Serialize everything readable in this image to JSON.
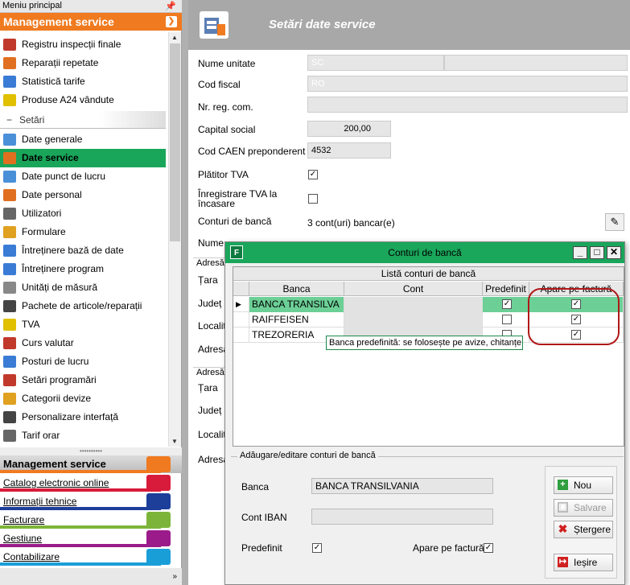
{
  "left_pane": {
    "title": "Meniu principal",
    "pin": "⌂",
    "module_header": "Management service",
    "nav_items": [
      {
        "label": "Registru inspecții finale",
        "icon": "registry-icon",
        "color": "#c0392b"
      },
      {
        "label": "Reparații repetate",
        "icon": "repair-icon",
        "color": "#e07020"
      },
      {
        "label": "Statistică tarife",
        "icon": "chart-icon",
        "color": "#3a7bd5"
      },
      {
        "label": "Produse A24 vândute",
        "icon": "a24-icon",
        "color": "#e0c000"
      }
    ],
    "section": "Setări",
    "settings_items": [
      {
        "label": "Date generale",
        "icon": "general-data-icon",
        "color": "#4a90d9"
      },
      {
        "label": "Date service",
        "icon": "service-data-icon",
        "color": "#e07020",
        "active": true
      },
      {
        "label": "Date punct de lucru",
        "icon": "workpoint-icon",
        "color": "#4a90d9"
      },
      {
        "label": "Date personal",
        "icon": "staff-icon",
        "color": "#e07020"
      },
      {
        "label": "Utilizatori",
        "icon": "users-icon",
        "color": "#666666"
      },
      {
        "label": "Formulare",
        "icon": "forms-icon",
        "color": "#e0a020"
      },
      {
        "label": "Întreținere bază de date",
        "icon": "database-icon",
        "color": "#3a7bd5"
      },
      {
        "label": "Întreținere program",
        "icon": "program-icon",
        "color": "#3a7bd5"
      },
      {
        "label": "Unități de măsură",
        "icon": "units-icon",
        "color": "#888888"
      },
      {
        "label": "Pachete de articole/reparații",
        "icon": "packages-icon",
        "color": "#444444"
      },
      {
        "label": "TVA",
        "icon": "vat-icon",
        "color": "#e0c000"
      },
      {
        "label": "Curs valutar",
        "icon": "currency-icon",
        "color": "#c0392b"
      },
      {
        "label": "Posturi de lucru",
        "icon": "workstations-icon",
        "color": "#3a7bd5"
      },
      {
        "label": "Setări programări",
        "icon": "scheduling-icon",
        "color": "#c0392b"
      },
      {
        "label": "Categorii devize",
        "icon": "categories-icon",
        "color": "#e0a020"
      },
      {
        "label": "Personalizare interfață",
        "icon": "interface-icon",
        "color": "#444444"
      },
      {
        "label": "Tarif orar",
        "icon": "hourly-rate-icon",
        "color": "#666666"
      }
    ],
    "modules": [
      {
        "label": "Management service",
        "color": "#f07a1f",
        "selected": true
      },
      {
        "label": "Catalog electronic online",
        "color": "#d81b3a"
      },
      {
        "label": "Informații tehnice",
        "color": "#1d3f9a"
      },
      {
        "label": "Facturare",
        "color": "#7cb43a"
      },
      {
        "label": "Gestiune",
        "color": "#9b1b8a"
      },
      {
        "label": "Contabilizare",
        "color": "#1a9ed8"
      }
    ],
    "footer": "»"
  },
  "main": {
    "title": "Setări date service",
    "fields": {
      "nume_unitate": {
        "label": "Nume unitate",
        "value": "SC"
      },
      "cod_fiscal": {
        "label": "Cod fiscal",
        "value": "RO"
      },
      "nr_reg_com": {
        "label": "Nr. reg. com.",
        "value": ""
      },
      "capital_social": {
        "label": "Capital social",
        "value": "200,00"
      },
      "cod_caen": {
        "label": "Cod CAEN preponderent",
        "value": "4532"
      },
      "platitor_tva": {
        "label": "Plătitor TVA",
        "checked": "✓"
      },
      "tva_incasare": {
        "label": "Înregistrare TVA la încasare",
        "checked": ""
      },
      "conturi": {
        "label": "Conturi de bancă",
        "value": "3 cont(uri) bancar(e)"
      },
      "nume_partial": {
        "label": "Nume"
      }
    },
    "address_groups": [
      {
        "title": "Adresă",
        "labels": [
          "Țara",
          "Județ",
          "Localit",
          "Adresa"
        ]
      },
      {
        "title": "Adresă",
        "labels": [
          "Țara",
          "Județ",
          "Localit",
          "Adresa"
        ]
      }
    ]
  },
  "dialog": {
    "title": "Conturi de bancă",
    "grid": {
      "caption": "Listă conturi de bancă",
      "columns": [
        "Banca",
        "Cont",
        "Predefinit",
        "Apare pe factură"
      ],
      "rows": [
        {
          "banca": "BANCA TRANSILVA",
          "predefinit": "✓",
          "apare": "✓",
          "selected": true
        },
        {
          "banca": "RAIFFEISEN",
          "predefinit": "",
          "apare": "✓"
        },
        {
          "banca": "TREZORERIA",
          "predefinit": "",
          "apare": "✓"
        }
      ]
    },
    "tooltip": "Banca predefinită: se folosește pe avize, chitanțe",
    "edit": {
      "title": "Adăugare/editare conturi de bancă",
      "banca_label": "Banca",
      "banca_value": "BANCA TRANSILVANIA",
      "iban_label": "Cont IBAN",
      "predefinit_label": "Predefinit",
      "predefinit_checked": "✓",
      "apare_label": "Apare pe factură",
      "apare_checked": "✓"
    },
    "buttons": {
      "nou": "Nou",
      "salvare": "Salvare",
      "stergere": "Ștergere",
      "iesire": "Ieșire"
    }
  }
}
